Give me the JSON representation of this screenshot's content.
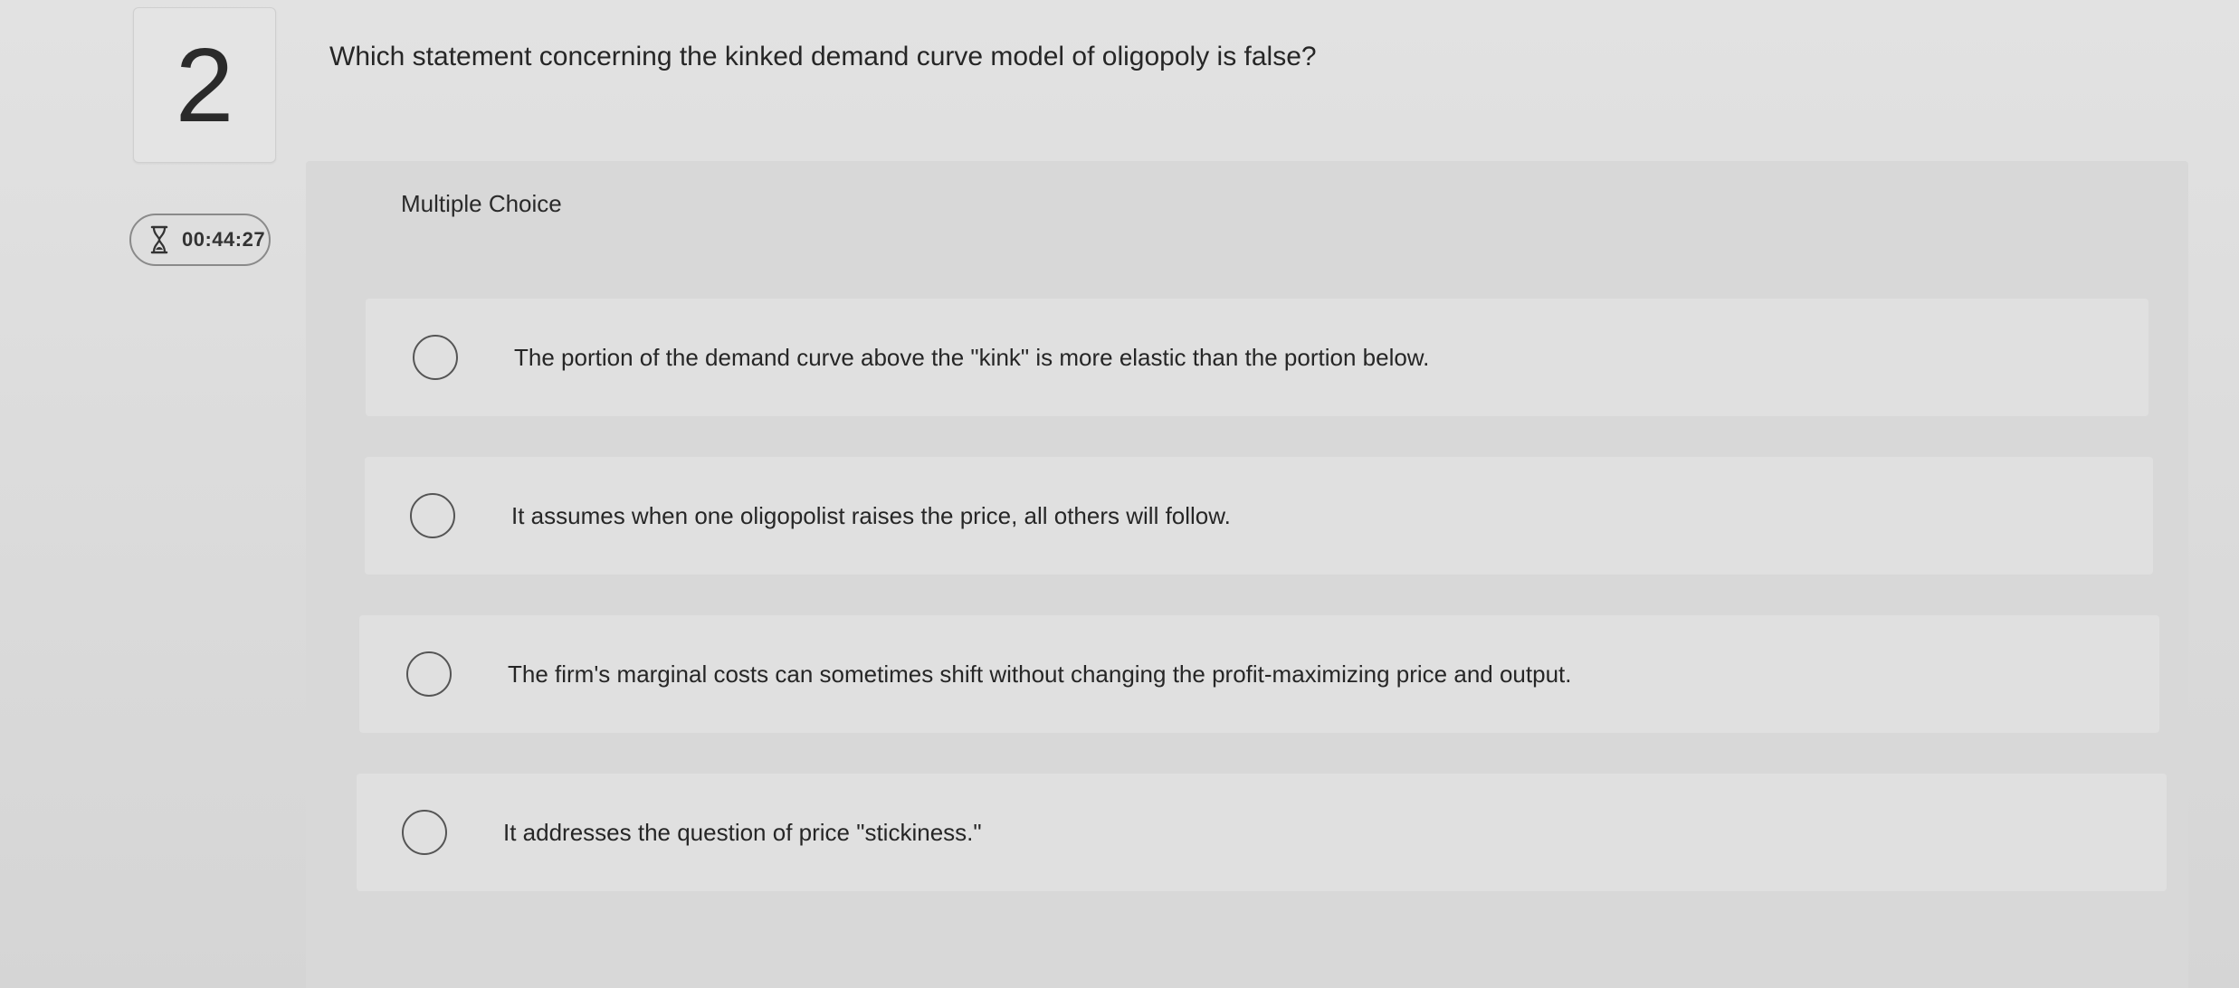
{
  "question": {
    "number": "2",
    "prompt": "Which statement concerning the kinked demand curve model of oligopoly is false?",
    "type_label": "Multiple Choice"
  },
  "timer": {
    "icon": "hourglass-icon",
    "value": "00:44:27"
  },
  "options": [
    {
      "label": "The portion of the demand curve above the \"kink\" is more elastic than the portion below."
    },
    {
      "label": "It assumes when one oligopolist raises the price, all others will follow."
    },
    {
      "label": "The firm's marginal costs can sometimes shift without changing the profit-maximizing price and output."
    },
    {
      "label": "It addresses the question of price \"stickiness.\""
    }
  ],
  "colors": {
    "background": "#dcdcdc",
    "panel": "#d8d8d8",
    "option_background": "#e0e0e0",
    "text": "#262626"
  }
}
